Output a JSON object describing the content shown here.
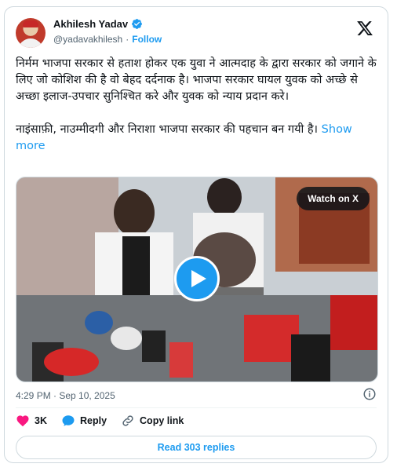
{
  "author": {
    "name": "Akhilesh Yadav",
    "handle": "@yadavakhilesh",
    "separator": "·",
    "follow_label": "Follow"
  },
  "tweet": {
    "text": "निर्मम भाजपा सरकार से हताश होकर एक युवा ने आत्मदाह के द्वारा सरकार को जगाने के लिए जो कोशिश की है वो बेहद दर्दनाक है। भाजपा सरकार घायल युवक को अच्छे से अच्छा इलाज-उपचार सुनिश्चित करे और युवक को न्याय प्रदान करे।\n\nनाइंसाफ़ी, नाउम्मीदगी और निराशा भाजपा सरकार की पहचान बन गयी है।",
    "show_more_label": "Show more"
  },
  "media": {
    "watch_label": "Watch on X"
  },
  "meta": {
    "timestamp": "4:29 PM · Sep 10, 2025"
  },
  "actions": {
    "likes_count": "3K",
    "reply_label": "Reply",
    "copy_link_label": "Copy link"
  },
  "replies": {
    "label": "Read 303 replies"
  },
  "colors": {
    "accent": "#1d9bf0",
    "like": "#f91880",
    "muted": "#536471"
  }
}
